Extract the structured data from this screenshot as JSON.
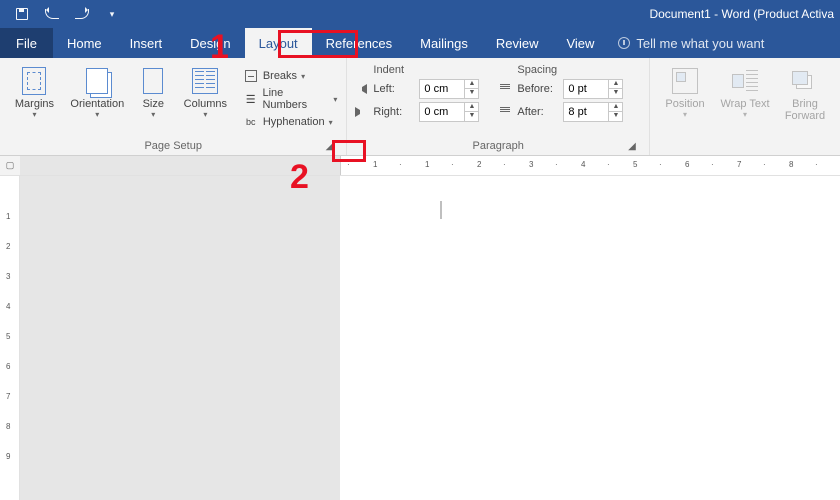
{
  "window": {
    "title": "Document1 - Word (Product Activa"
  },
  "qat": {
    "save": "Save",
    "undo": "Undo",
    "redo": "Redo",
    "customize": "Customize"
  },
  "tabs": {
    "file": "File",
    "items": [
      {
        "label": "Home"
      },
      {
        "label": "Insert"
      },
      {
        "label": "Design"
      },
      {
        "label": "Layout"
      },
      {
        "label": "References"
      },
      {
        "label": "Mailings"
      },
      {
        "label": "Review"
      },
      {
        "label": "View"
      }
    ],
    "active_index": 3,
    "tell_me": "Tell me what you want"
  },
  "ribbon": {
    "page_setup": {
      "title": "Page Setup",
      "margins": "Margins",
      "orientation": "Orientation",
      "size": "Size",
      "columns": "Columns",
      "breaks": "Breaks",
      "line_numbers": "Line Numbers",
      "hyphenation": "Hyphenation",
      "bc_prefix": "bc"
    },
    "paragraph": {
      "title": "Paragraph",
      "indent_header": "Indent",
      "spacing_header": "Spacing",
      "left_label": "Left:",
      "right_label": "Right:",
      "before_label": "Before:",
      "after_label": "After:",
      "left_value": "0 cm",
      "right_value": "0 cm",
      "before_value": "0 pt",
      "after_value": "8 pt"
    },
    "arrange": {
      "position": "Position",
      "wrap_text": "Wrap Text",
      "bring_forward": "Bring Forward"
    }
  },
  "ruler": {
    "marks": [
      " ",
      "1",
      " ",
      "1",
      " ",
      "2",
      " ",
      "3",
      " ",
      "4",
      " ",
      "5",
      " ",
      "6",
      " ",
      "7",
      " ",
      "8",
      " ",
      "9"
    ]
  },
  "annotations": {
    "one": "1",
    "two": "2"
  }
}
